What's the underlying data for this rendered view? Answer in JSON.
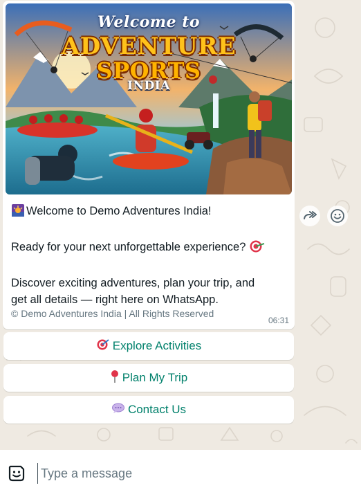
{
  "message": {
    "banner": {
      "welcome": "Welcome to",
      "title_line1": "ADVENTURE",
      "title_line2": "SPORTS",
      "title_line3": "INDIA"
    },
    "greeting": "Welcome to Demo Adventures India!",
    "line2": "Ready for your next unforgettable experience?",
    "line3a": "Discover exciting adventures, plan your trip, and",
    "line3b": "get all details — right here on WhatsApp.",
    "footer": "© Demo Adventures India | All Rights Reserved",
    "time": "06:31"
  },
  "buttons": [
    {
      "label": "Explore Activities",
      "icon": "dart-icon"
    },
    {
      "label": "Plan My Trip",
      "icon": "pushpin-icon"
    },
    {
      "label": "Contact Us",
      "icon": "speech-bubble-icon"
    }
  ],
  "side_actions": {
    "forward": "forward-icon",
    "react": "emoji-icon"
  },
  "composer": {
    "placeholder": "Type a message",
    "value": ""
  }
}
